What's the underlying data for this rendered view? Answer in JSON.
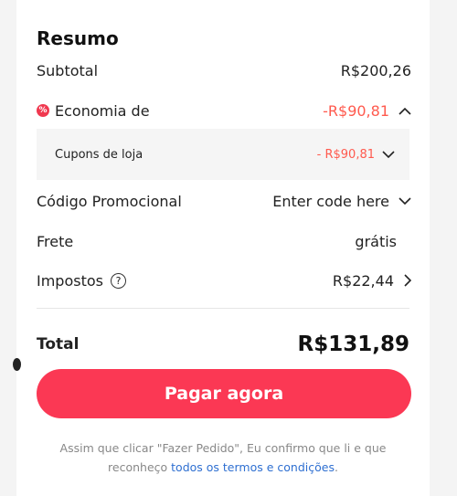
{
  "summary": {
    "title": "Resumo",
    "subtotal": {
      "label": "Subtotal",
      "value": "R$200,26"
    },
    "savings": {
      "badge": "%",
      "label": "Economia de",
      "value": "-R$90,81",
      "icon": "chevron-up-icon"
    },
    "coupons": {
      "label": "Cupons de loja",
      "value": "- R$90,81",
      "icon": "chevron-down-icon"
    },
    "promo": {
      "label": "Código Promocional",
      "value": "Enter code here",
      "icon": "chevron-down-icon"
    },
    "shipping": {
      "label": "Frete",
      "value": "grátis"
    },
    "taxes": {
      "label": "Impostos",
      "help": "?",
      "value": "R$22,44",
      "icon": "chevron-right-icon"
    },
    "total": {
      "label": "Total",
      "value": "R$131,89"
    }
  },
  "actions": {
    "pay_label": "Pagar agora"
  },
  "disclaimer": {
    "text": "Assim que clicar \"Fazer Pedido\", Eu confirmo que li e que reconheço ",
    "link": "todos os termos e condições",
    "end": "."
  },
  "colors": {
    "accent": "#fb3854",
    "discount": "#ff5a4e",
    "link": "#2e6fd1"
  }
}
